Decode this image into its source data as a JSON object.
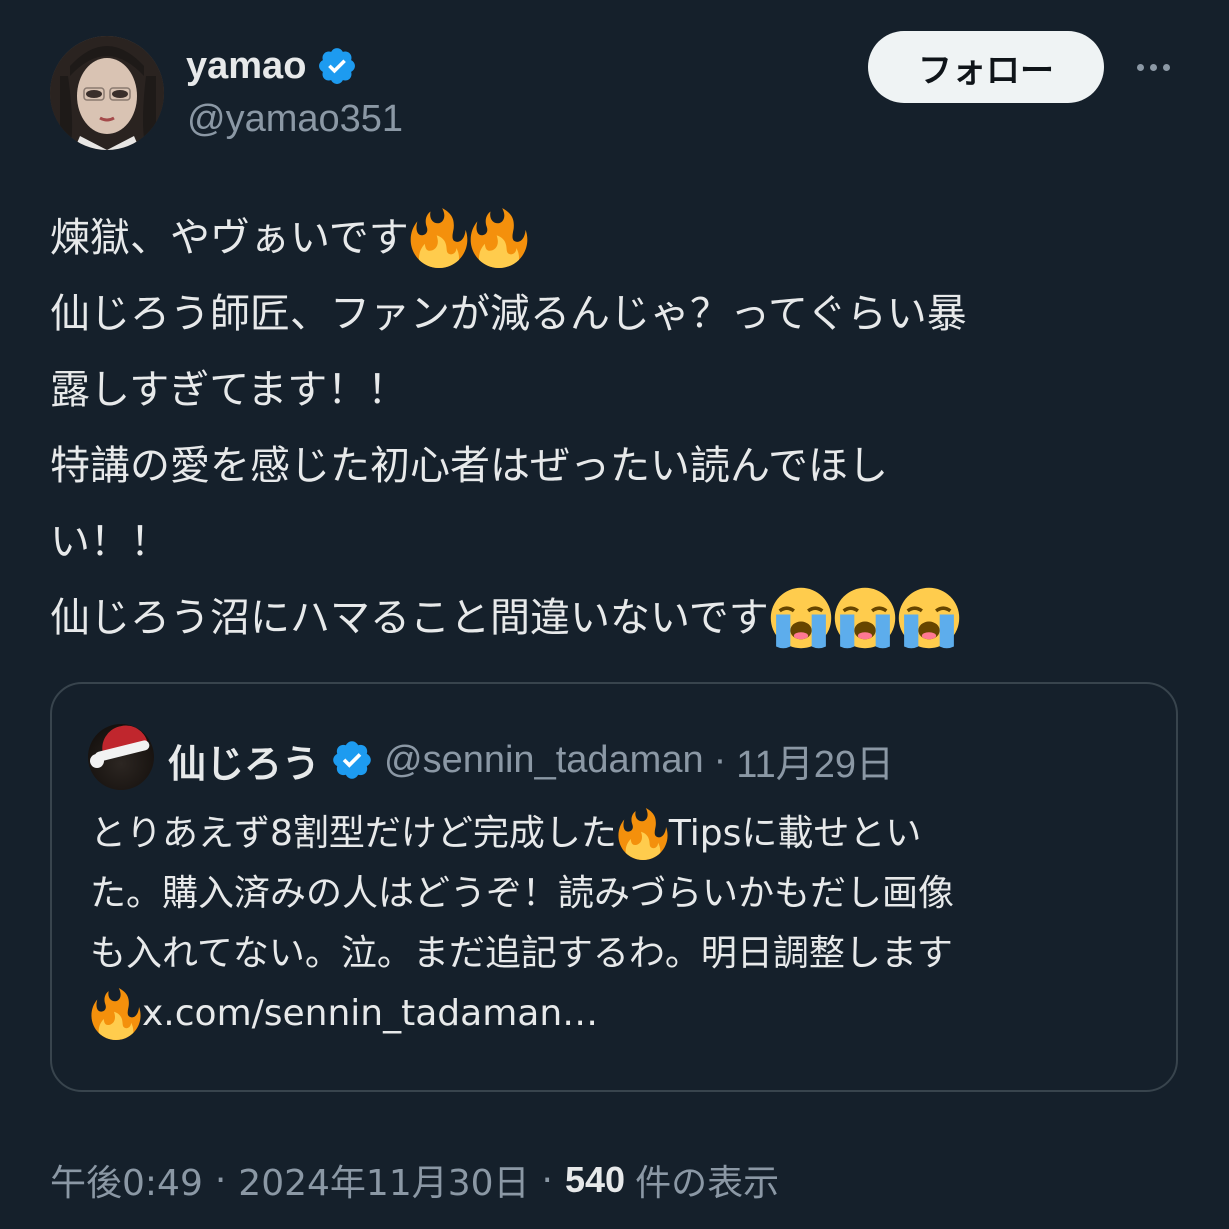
{
  "author": {
    "display_name": "yamao",
    "handle": "@yamao351",
    "verified": true
  },
  "actions": {
    "follow_label": "フォロー",
    "more_icon": "ellipsis-icon"
  },
  "tweet": {
    "lines": [
      {
        "text": "煉獄、やヴぁいです",
        "emojis": [
          "fire",
          "fire"
        ]
      },
      {
        "text": "仙じろう師匠、ファンが減るんじゃ？ってぐらい暴",
        "emojis": []
      },
      {
        "text": "露しすぎてます！！",
        "emojis": []
      },
      {
        "text": "特講の愛を感じた初心者はぜったい読んでほし",
        "emojis": []
      },
      {
        "text": "い！！",
        "emojis": []
      },
      {
        "text": "仙じろう沼にハマること間違いないです",
        "emojis": [
          "crying",
          "crying",
          "crying"
        ]
      }
    ]
  },
  "quote": {
    "display_name": "仙じろう",
    "handle": "@sennin_tadaman",
    "separator": "·",
    "date": "11月29日",
    "verified": true,
    "lines": [
      {
        "text_before": "とりあえず8割型だけど完成した",
        "emoji": "fire",
        "text_after": "Tipsに載せとい"
      },
      {
        "text_before": "た。購入済みの人はどうぞ！読みづらいかもだし画像",
        "emoji": null,
        "text_after": ""
      },
      {
        "text_before": "も入れてない。泣。まだ追記するわ。明日調整します",
        "emoji": null,
        "text_after": ""
      },
      {
        "text_before": "",
        "emoji": "fire",
        "text_after": " x.com/sennin_tadaman…"
      }
    ]
  },
  "meta": {
    "time": "午後0:49",
    "separator": "·",
    "date": "2024年11月30日",
    "views_count": "540",
    "views_label": "件の表示"
  },
  "colors": {
    "background": "#15202b",
    "text_primary": "#e7e9ea",
    "text_secondary": "#8b98a5",
    "verified_blue": "#1d9bf0",
    "border": "#38444d",
    "follow_bg": "#eff3f4"
  }
}
